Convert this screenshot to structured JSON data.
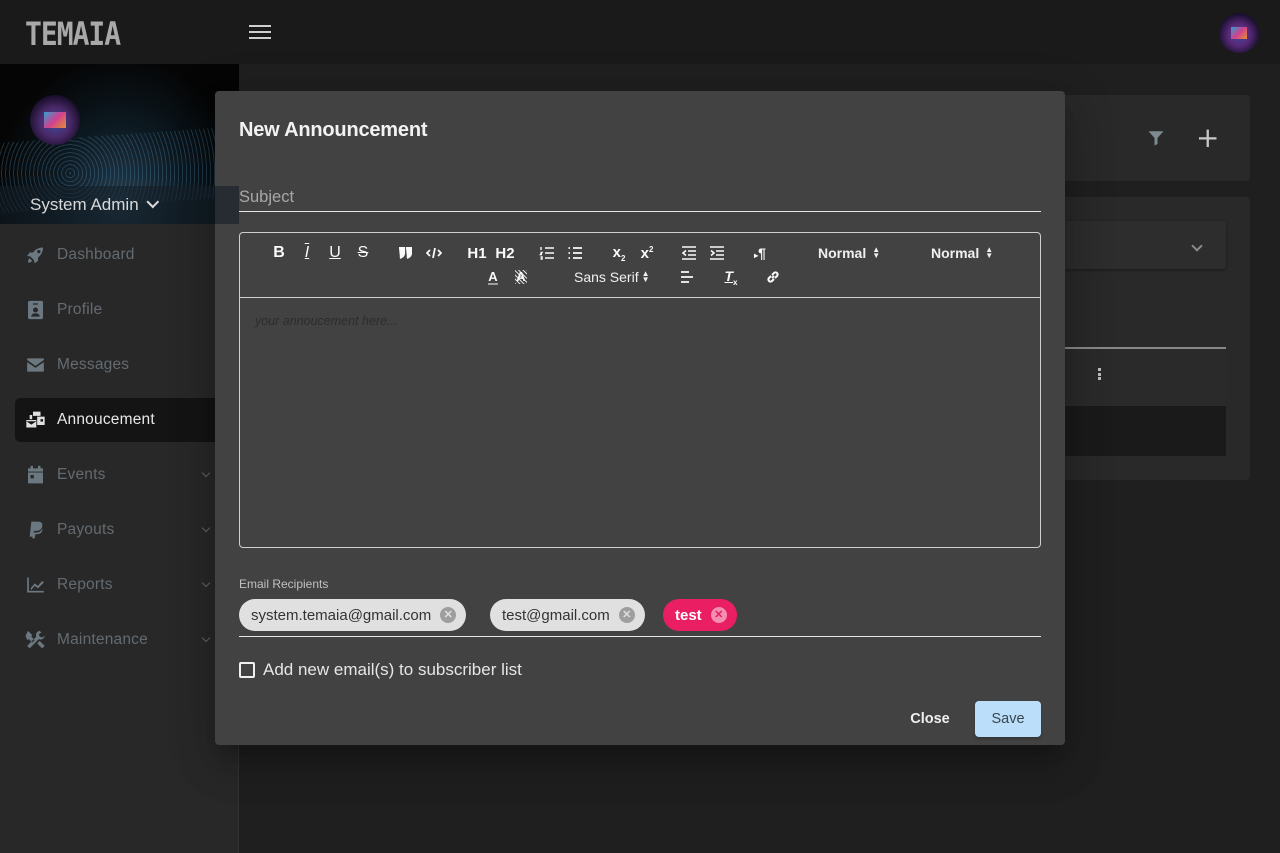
{
  "app": {
    "logo_text": "TEMAIA"
  },
  "sidebar": {
    "user_name": "System Admin",
    "items": [
      {
        "label": "Dashboard",
        "icon": "rocket-icon",
        "active": false,
        "expandable": false
      },
      {
        "label": "Profile",
        "icon": "id-badge-icon",
        "active": false,
        "expandable": false
      },
      {
        "label": "Messages",
        "icon": "envelope-icon",
        "active": false,
        "expandable": false
      },
      {
        "label": "Annoucement",
        "icon": "mail-bulk-icon",
        "active": true,
        "expandable": false
      },
      {
        "label": "Events",
        "icon": "calendar-icon",
        "active": false,
        "expandable": true
      },
      {
        "label": "Payouts",
        "icon": "paypal-icon",
        "active": false,
        "expandable": true
      },
      {
        "label": "Reports",
        "icon": "chart-line-icon",
        "active": false,
        "expandable": true
      },
      {
        "label": "Maintenance",
        "icon": "tools-icon",
        "active": false,
        "expandable": true
      }
    ]
  },
  "background": {
    "filter_icon": "filter-icon",
    "add_icon": "plus-icon",
    "add_glyph": "+"
  },
  "modal": {
    "title": "New Announcement",
    "subject": {
      "placeholder": "Subject",
      "value": ""
    },
    "editor": {
      "placeholder": "your annoucement here...",
      "toolbar": {
        "bold": "B",
        "italic": "I",
        "underline": "U",
        "strike": "S",
        "header1": "H1",
        "header2": "H2",
        "sub": "x",
        "sup": "x",
        "size_select": "Normal",
        "header_select": "Normal",
        "font_select": "Sans Serif"
      }
    },
    "recipients": {
      "label": "Email Recipients",
      "chips": [
        {
          "label": "system.temaia@gmail.com",
          "valid": true
        },
        {
          "label": "test@gmail.com",
          "valid": true
        },
        {
          "label": "test",
          "valid": false
        }
      ],
      "error_color": "#e91e63"
    },
    "subscribe_checkbox": {
      "label": "Add new email(s) to subscriber list",
      "checked": false
    },
    "buttons": {
      "close": "Close",
      "save": "Save"
    },
    "save_color": "#bbdefb"
  }
}
